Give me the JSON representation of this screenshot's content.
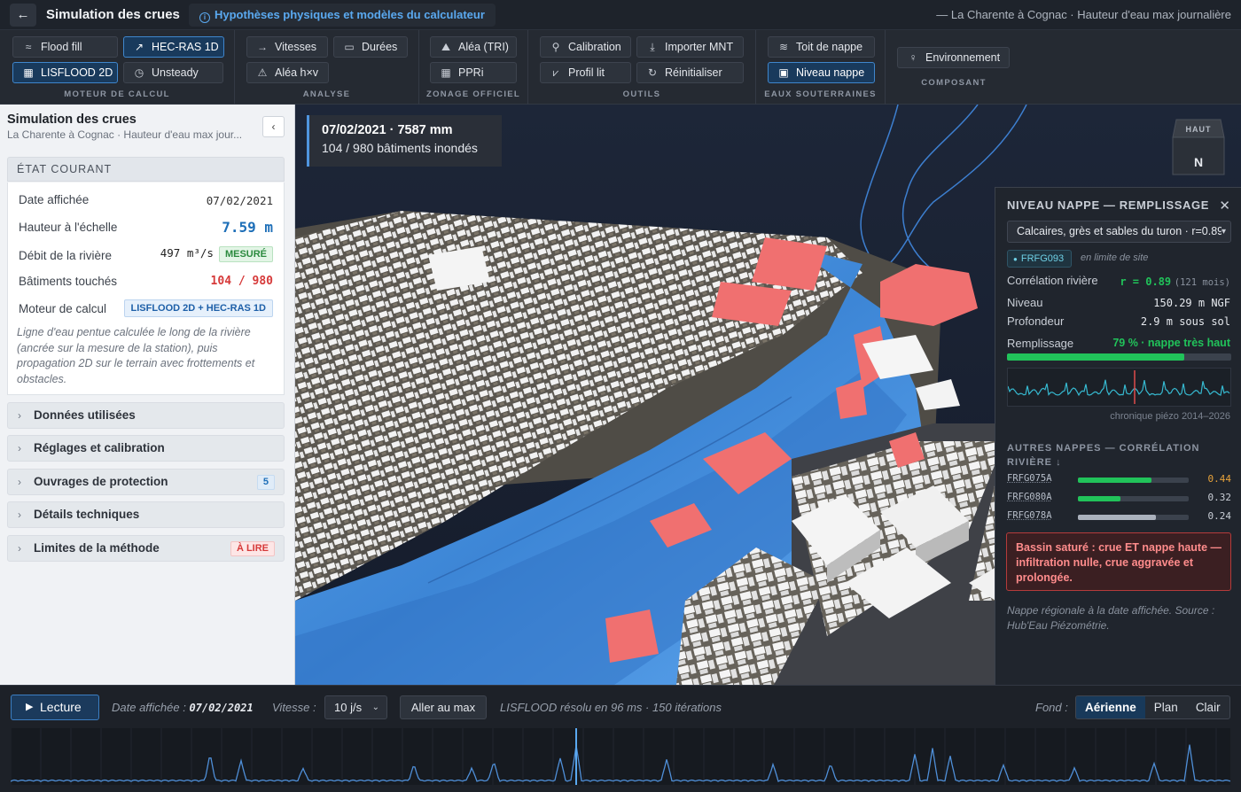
{
  "topbar": {
    "back_icon": "arrow-left-icon",
    "title": "Simulation des crues",
    "hypotheses_label": "Hypothèses physiques et modèles du calculateur",
    "context": "— La Charente à Cognac · Hauteur d'eau max journalière"
  },
  "toolbar": {
    "groups": [
      {
        "label": "MOTEUR DE CALCUL",
        "buttons": [
          {
            "label": "Flood fill",
            "icon": "waves-icon",
            "active": false
          },
          {
            "label": "HEC-RAS 1D",
            "icon": "trend-icon",
            "active": true
          },
          {
            "label": "LISFLOOD 2D",
            "icon": "grid-icon",
            "active": true
          },
          {
            "label": "Unsteady",
            "icon": "clock-icon",
            "active": false
          }
        ]
      },
      {
        "label": "ANALYSE",
        "buttons": [
          {
            "label": "Vitesses",
            "icon": "arrow-right-icon",
            "active": false
          },
          {
            "label": "Durées",
            "icon": "calendar-icon",
            "active": false
          },
          {
            "label": "Aléa h×v",
            "icon": "warning-icon",
            "active": false
          }
        ]
      },
      {
        "label": "ZONAGE OFFICIEL",
        "buttons": [
          {
            "label": "Aléa (TRI)",
            "icon": "mountain-icon",
            "active": false
          },
          {
            "label": "PPRi",
            "icon": "grid-icon",
            "active": false
          }
        ]
      },
      {
        "label": "OUTILS",
        "buttons": [
          {
            "label": "Calibration",
            "icon": "pin-icon",
            "active": false
          },
          {
            "label": "Importer MNT",
            "icon": "download-icon",
            "active": false
          },
          {
            "label": "Profil lit",
            "icon": "profile-icon",
            "active": false
          },
          {
            "label": "Réinitialiser",
            "icon": "reset-icon",
            "active": false
          }
        ]
      },
      {
        "label": "EAUX SOUTERRAINES",
        "buttons": [
          {
            "label": "Toit de nappe",
            "icon": "layers-icon",
            "active": false
          },
          {
            "label": "Niveau nappe",
            "icon": "gauge-icon",
            "active": true
          }
        ]
      },
      {
        "label": "COMPOSANT",
        "buttons": [
          {
            "label": "Environnement",
            "icon": "bulb-icon",
            "active": false
          }
        ]
      }
    ]
  },
  "left": {
    "title": "Simulation des crues",
    "subtitle": "La Charente à Cognac · Hauteur d'eau max jour...",
    "collapse_icon": "chevron-left-icon",
    "etat_title": "ÉTAT COURANT",
    "rows": {
      "date_label": "Date affichée",
      "date_value": "07/02/2021",
      "hauteur_label": "Hauteur à l'échelle",
      "hauteur_value": "7.59 m",
      "debit_label": "Débit de la rivière",
      "debit_value": "497 m³/s",
      "debit_badge": "MESURÉ",
      "batiments_label": "Bâtiments touchés",
      "batiments_value": "104 / 980",
      "moteur_label": "Moteur de calcul",
      "moteur_value": "LISFLOOD 2D + HEC-RAS 1D"
    },
    "note": "Ligne d'eau pentue calculée le long de la rivière (ancrée sur la mesure de la station), puis propagation 2D sur le terrain avec frottements et obstacles.",
    "sections": [
      {
        "label": "Données utilisées",
        "badge": ""
      },
      {
        "label": "Réglages et calibration",
        "badge": ""
      },
      {
        "label": "Ouvrages de protection",
        "badge": "5"
      },
      {
        "label": "Détails techniques",
        "badge": ""
      },
      {
        "label": "Limites de la méthode",
        "badge": "À LIRE"
      }
    ]
  },
  "map": {
    "info_date": "07/02/2021 · 7587 mm",
    "info_buildings": "104 / 980 bâtiments inondés",
    "compass_up": "HAUT",
    "compass_north": "N"
  },
  "nappe": {
    "title": "NIVEAU NAPPE — REMPLISSAGE",
    "close_icon": "close-icon",
    "select_value": "Calcaires, grès et sables du turon · r=0.89",
    "code": "FRFG093",
    "limit_note": "en limite de site",
    "corr_label": "Corrélation rivière",
    "corr_value": "r = 0.89",
    "corr_months": "(121 mois)",
    "niveau_label": "Niveau",
    "niveau_value": "150.29 m NGF",
    "prof_label": "Profondeur",
    "prof_value": "2.9 m sous sol",
    "fill_label": "Remplissage",
    "fill_value": "79 % · nappe très haut",
    "fill_percent": 79,
    "spark_caption": "chronique piézo 2014–2026",
    "others_title": "AUTRES NAPPES — CORRÉLATION RIVIÈRE ↓",
    "others": [
      {
        "code": "FRFG075A",
        "value": "0.44",
        "fraction": 0.66,
        "color": "#21c35a",
        "text_color": "#e8a33a"
      },
      {
        "code": "FRFG080A",
        "value": "0.32",
        "fraction": 0.38,
        "color": "#21c35a",
        "text_color": "#c9ced6"
      },
      {
        "code": "FRFG078A",
        "value": "0.24",
        "fraction": 0.7,
        "color": "#aab1bc",
        "text_color": "#c9ced6"
      }
    ],
    "alert": "Bassin saturé : crue ET nappe haute — infiltration nulle, crue aggravée et prolongée.",
    "source": "Nappe régionale à la date affichée. Source : Hub'Eau Piézométrie."
  },
  "bottom": {
    "play_label": "Lecture",
    "play_icon": "play-icon",
    "date_label": "Date affichée :",
    "date_value": "07/02/2021",
    "speed_label": "Vitesse :",
    "speed_value": "10 j/s",
    "goto_label": "Aller au max",
    "solver_info": "LISFLOOD résolu en 96 ms · 150 itérations",
    "fond_label": "Fond :",
    "fond_options": [
      "Aérienne",
      "Plan",
      "Clair"
    ],
    "fond_selected": "Aérienne"
  },
  "colors": {
    "accent": "#3f86cc",
    "water": "#3f8fe0",
    "flooded_building": "#f07070",
    "positive": "#21c35a",
    "danger": "#d63a3a",
    "link": "#1e6fb8"
  }
}
